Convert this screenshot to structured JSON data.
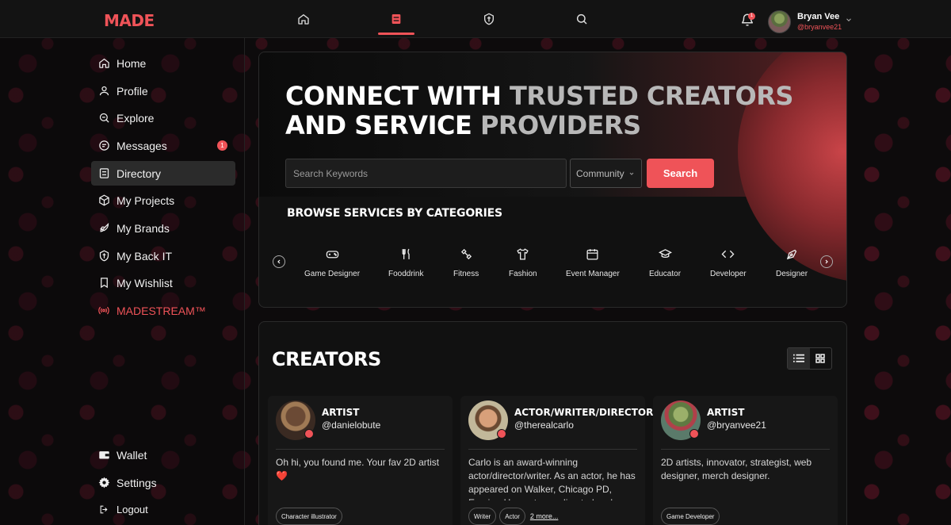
{
  "brand": {
    "logo": "MADE",
    "accent": "#ef5358"
  },
  "topbar": {
    "nav": [
      {
        "name": "home-icon",
        "active": false
      },
      {
        "name": "directory-icon",
        "active": true
      },
      {
        "name": "shield-icon",
        "active": false
      },
      {
        "name": "search-icon",
        "active": false
      }
    ],
    "notifications_badge": "1",
    "user": {
      "name": "Bryan Vee",
      "handle": "@bryanvee21"
    }
  },
  "sidebar": {
    "items": [
      {
        "label": "Home",
        "icon": "home-icon"
      },
      {
        "label": "Profile",
        "icon": "user-icon"
      },
      {
        "label": "Explore",
        "icon": "explore-icon"
      },
      {
        "label": "Messages",
        "icon": "message-icon",
        "badge": "1"
      },
      {
        "label": "Directory",
        "icon": "directory-icon",
        "active": true
      },
      {
        "label": "My Projects",
        "icon": "cube-icon"
      },
      {
        "label": "My Brands",
        "icon": "rocket-icon"
      },
      {
        "label": "My Back IT",
        "icon": "shield-icon"
      },
      {
        "label": "My Wishlist",
        "icon": "bookmark-icon"
      },
      {
        "label": "MADESTREAM™",
        "icon": "broadcast-icon"
      }
    ],
    "bottom": [
      {
        "label": "Wallet",
        "icon": "wallet-icon"
      },
      {
        "label": "Settings",
        "icon": "gear-icon"
      },
      {
        "label": "Logout",
        "icon": "logout-icon"
      }
    ]
  },
  "hero": {
    "title_line1_a": "CONNECT WITH ",
    "title_line1_b": "TRUSTED CREATORS",
    "title_line2_a": "AND SERVICE ",
    "title_line2_b": "PROVIDERS",
    "search_placeholder": "Search Keywords",
    "community_value": "Community",
    "search_button": "Search"
  },
  "browse": {
    "title": "BROWSE SERVICES BY CATEGORIES",
    "categories": [
      {
        "label": "Game Designer",
        "icon": "gamepad-icon"
      },
      {
        "label": "Fooddrink",
        "icon": "utensils-icon"
      },
      {
        "label": "Fitness",
        "icon": "dumbbell-icon"
      },
      {
        "label": "Fashion",
        "icon": "shirt-icon"
      },
      {
        "label": "Event Manager",
        "icon": "calendar-icon"
      },
      {
        "label": "Educator",
        "icon": "graduation-cap-icon"
      },
      {
        "label": "Developer",
        "icon": "code-icon"
      },
      {
        "label": "Designer",
        "icon": "pen-tool-icon"
      }
    ]
  },
  "creators": {
    "title": "CREATORS",
    "cards": [
      {
        "role": "ARTIST",
        "handle": "@danielobute",
        "bio": "Oh hi, you found me. Your fav 2D artist❤️",
        "tags": [
          "Character illustrator"
        ],
        "more": ""
      },
      {
        "role": "ACTOR/WRITER/DIRECTOR",
        "handle": "@therealcarlo",
        "bio": "Carlo is an award-winning actor/director/writer. As an actor, he has appeared on Walker, Chicago PD, Empire. He wrote, co-directed and starred in the",
        "tags": [
          "Writer",
          "Actor"
        ],
        "more": "2 more..."
      },
      {
        "role": "ARTIST",
        "handle": "@bryanvee21",
        "bio": "2D artists, innovator, strategist, web designer, merch designer.",
        "tags": [
          "Game Developer"
        ],
        "more": ""
      }
    ]
  }
}
